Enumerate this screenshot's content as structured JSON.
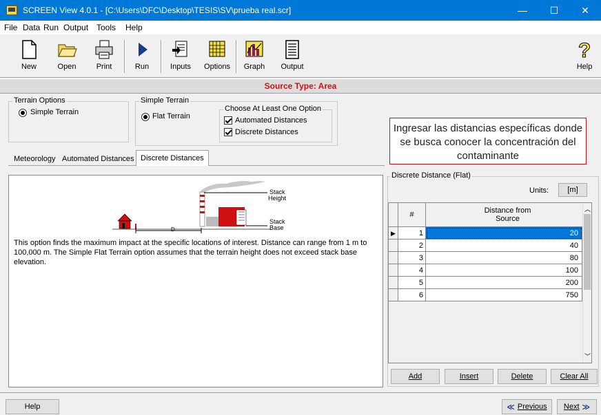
{
  "window": {
    "title": "SCREEN View 4.0.1 - [C:\\Users\\DFC\\Desktop\\TESIS\\SV\\prueba real.scr]",
    "minimize": "—",
    "maximize": "☐",
    "close": "✕"
  },
  "menu": [
    "File",
    "Data",
    "Run",
    "Output",
    "Tools",
    "Help"
  ],
  "toolbar": {
    "new": "New",
    "open": "Open",
    "print": "Print",
    "run": "Run",
    "inputs": "Inputs",
    "options": "Options",
    "graph": "Graph",
    "output": "Output",
    "help": "Help"
  },
  "source_type": "Source Type: Area",
  "terrain_options": {
    "label": "Terrain Options",
    "simple": "Simple Terrain"
  },
  "simple_terrain": {
    "label": "Simple Terrain",
    "flat": "Flat Terrain",
    "choose_label": "Choose At Least One Option",
    "automated": "Automated Distances",
    "discrete": "Discrete Distances"
  },
  "note": "Ingresar las distancias específicas donde se busca conocer la concentración del contaminante",
  "tabs": {
    "meteorology": "Meteorology",
    "automated": "Automated Distances",
    "discrete": "Discrete Distances"
  },
  "illustration": {
    "stack_height": [
      "Stack",
      "Height"
    ],
    "stack_base": [
      "Stack",
      "Base"
    ],
    "d": "D"
  },
  "description": "This option finds the maximum impact at the specific locations of interest. Distance can range from 1 m to 100,000 m.  The Simple Flat Terrain option assumes that the terrain height does not exceed stack base elevation.",
  "discrete_panel": {
    "label": "Discrete Distance (Flat)",
    "units_label": "Units:",
    "units_value": "[m]",
    "col_num": "#",
    "col_distance": [
      "Distance from",
      "Source"
    ],
    "rows": [
      {
        "n": "1",
        "d": "20"
      },
      {
        "n": "2",
        "d": "40"
      },
      {
        "n": "3",
        "d": "80"
      },
      {
        "n": "4",
        "d": "100"
      },
      {
        "n": "5",
        "d": "200"
      },
      {
        "n": "6",
        "d": "750"
      }
    ],
    "buttons": {
      "add": "Add",
      "insert": "Insert",
      "delete": "Delete",
      "clear_all": "Clear All"
    }
  },
  "bottom": {
    "help": "Help",
    "previous": "Previous",
    "next": "Next"
  },
  "colors": {
    "title_bar": "#0078d7",
    "source_type": "#d01010",
    "selection": "#0078d7"
  }
}
